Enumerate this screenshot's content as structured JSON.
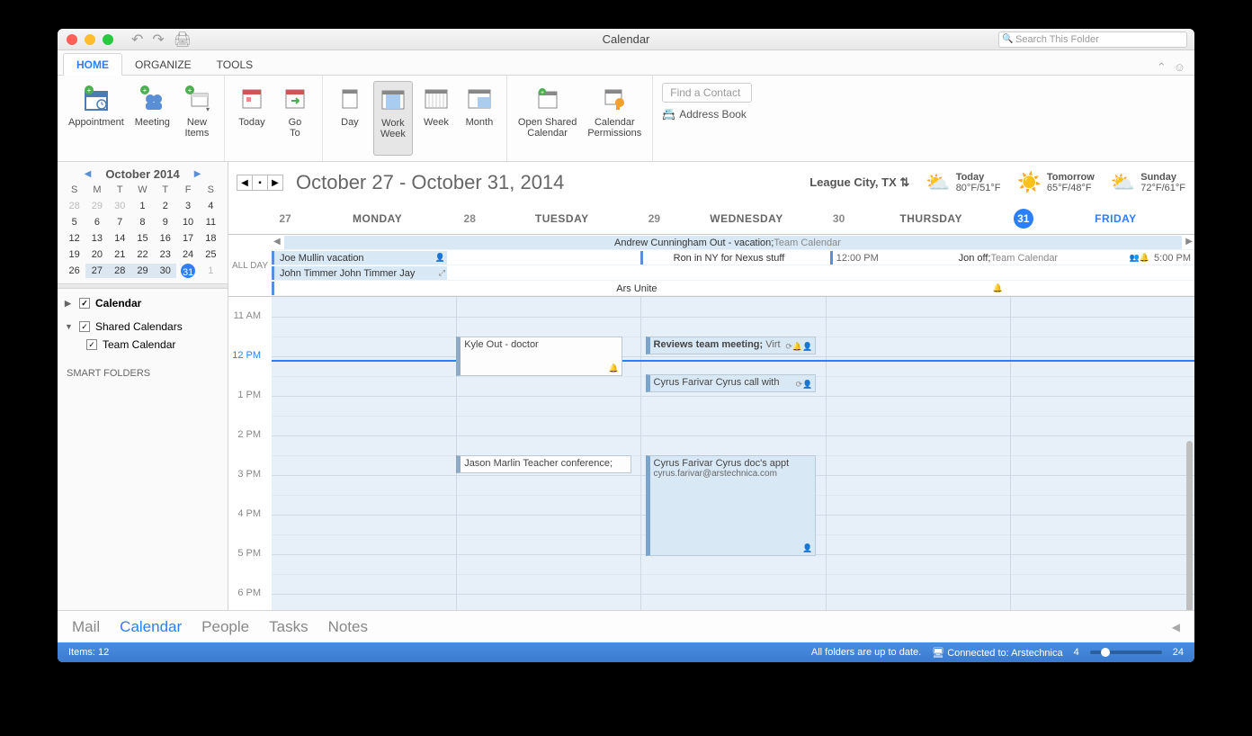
{
  "titlebar": {
    "title": "Calendar",
    "search_placeholder": "Search This Folder"
  },
  "tabs": {
    "home": "HOME",
    "organize": "ORGANIZE",
    "tools": "TOOLS"
  },
  "ribbon": {
    "appointment": "Appointment",
    "meeting": "Meeting",
    "new_items": "New\nItems",
    "today": "Today",
    "goto": "Go\nTo",
    "day": "Day",
    "work_week": "Work\nWeek",
    "week": "Week",
    "month": "Month",
    "open_shared": "Open Shared\nCalendar",
    "permissions": "Calendar\nPermissions",
    "find_contact": "Find a Contact",
    "address_book": "Address Book"
  },
  "mini": {
    "title": "October 2014",
    "dow": [
      "S",
      "M",
      "T",
      "W",
      "T",
      "F",
      "S"
    ],
    "prev": [
      "28",
      "29",
      "30",
      "1",
      "2",
      "3",
      "4"
    ],
    "rows": [
      [
        "5",
        "6",
        "7",
        "8",
        "9",
        "10",
        "11"
      ],
      [
        "12",
        "13",
        "14",
        "15",
        "16",
        "17",
        "18"
      ],
      [
        "19",
        "20",
        "21",
        "22",
        "23",
        "24",
        "25"
      ],
      [
        "26",
        "27",
        "28",
        "29",
        "30",
        "31",
        "1"
      ]
    ]
  },
  "sidebar": {
    "calendar": "Calendar",
    "shared": "Shared Calendars",
    "team": "Team Calendar",
    "smart": "SMART FOLDERS"
  },
  "main": {
    "date_range": "October 27 - October 31, 2014",
    "location": "League City, TX",
    "weather": [
      {
        "label": "Today",
        "temp": "80°F/51°F",
        "icon": "⛅"
      },
      {
        "label": "Tomorrow",
        "temp": "65°F/48°F",
        "icon": "☀️"
      },
      {
        "label": "Sunday",
        "temp": "72°F/61°F",
        "icon": "⛅"
      }
    ],
    "days": [
      {
        "num": "27",
        "name": "MONDAY"
      },
      {
        "num": "28",
        "name": "TUESDAY"
      },
      {
        "num": "29",
        "name": "WEDNESDAY"
      },
      {
        "num": "30",
        "name": "THURSDAY"
      },
      {
        "num": "31",
        "name": "FRIDAY"
      }
    ]
  },
  "allday": {
    "label": "ALL DAY",
    "r0": {
      "text": "Andrew Cunningham Out - vacation; ",
      "suffix": "Team Calendar"
    },
    "r1a": "Joe Mullin vacation",
    "r1b": "Ron in NY for Nexus stuff",
    "r1c_time": "12:00 PM",
    "r1c": "Jon off; ",
    "r1c_suffix": "Team Calendar",
    "r1c_end": "5:00 PM",
    "r2a": "John Timmer John Timmer Jay",
    "r3": "Ars Unite"
  },
  "hours": [
    "11 AM",
    "12 PM",
    "1 PM",
    "2 PM",
    "3 PM",
    "4 PM",
    "5 PM",
    "6 PM"
  ],
  "events": {
    "kyle": "Kyle Out - doctor",
    "reviews": "Reviews team meeting; ",
    "reviews_suffix": "Virt",
    "cyrus_call": "Cyrus Farivar Cyrus call with",
    "jason": "Jason Marlin Teacher conference;",
    "cyrus_doc": "Cyrus Farivar Cyrus doc's appt",
    "cyrus_email": "cyrus.farivar@arstechnica.com"
  },
  "bottom": {
    "mail": "Mail",
    "calendar": "Calendar",
    "people": "People",
    "tasks": "Tasks",
    "notes": "Notes"
  },
  "status": {
    "items": "Items: 12",
    "uptodate": "All folders are up to date.",
    "connected": "Connected to: Arstechnica",
    "zoom_min": "4",
    "zoom_max": "24"
  }
}
